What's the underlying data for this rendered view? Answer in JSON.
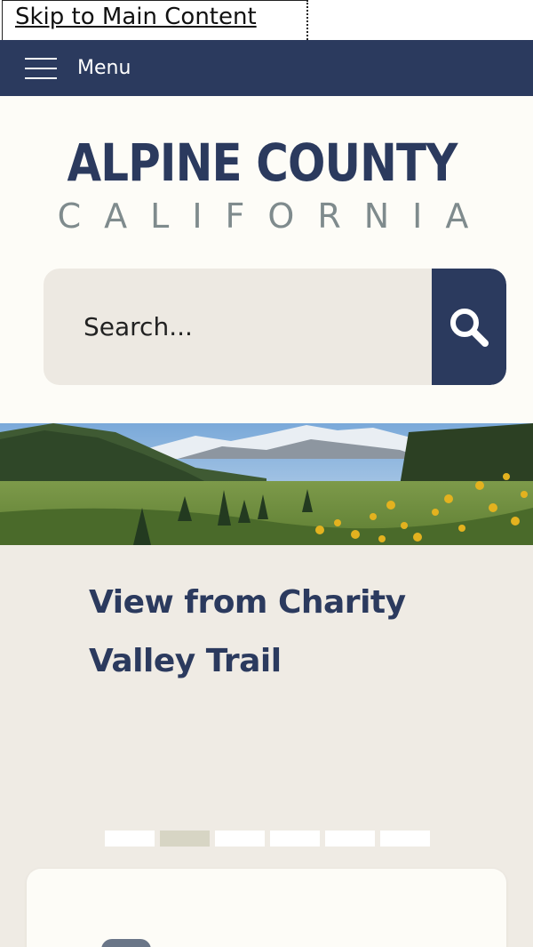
{
  "skip_link": {
    "label": "Skip to Main Content"
  },
  "nav": {
    "menu_label": "Menu"
  },
  "logo": {
    "title": "ALPINE COUNTY",
    "subtitle": "CALIFORNIA"
  },
  "search": {
    "placeholder": "Search..."
  },
  "slideshow": {
    "caption_line1": "View from Charity",
    "caption_line2": "Valley Trail",
    "slide_count": 6,
    "active_slide": 2
  },
  "colors": {
    "navy": "#2b3a5e",
    "page_bg": "#efebe4",
    "header_bg": "#fdfcf7",
    "search_bg": "#ede9e2",
    "logo_gray": "#7f8b8d",
    "dot_active": "#d7d5c4"
  },
  "icons": {
    "menu": "hamburger-icon",
    "search": "magnifier-icon",
    "card": "rounded-square-icon"
  }
}
